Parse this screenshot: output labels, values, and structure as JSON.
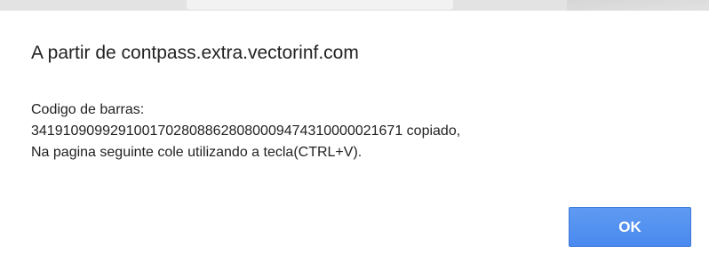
{
  "dialog": {
    "title": "A partir de contpass.extra.vectorinf.com",
    "message_lines": [
      "Codigo de barras:",
      "34191090992910017028088628080009474310000021671 copiado,",
      "Na pagina seguinte cole utilizando a tecla(CTRL+V)."
    ],
    "ok_label": "OK"
  },
  "colors": {
    "button_blue": "#4a89ef",
    "text": "#222222",
    "background": "#ffffff"
  }
}
